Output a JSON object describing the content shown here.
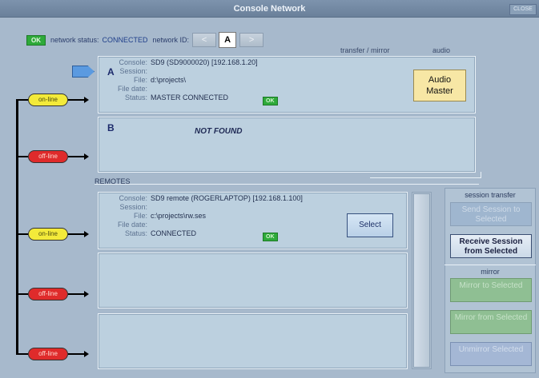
{
  "window": {
    "title": "Console Network",
    "close_label": "CLOSE"
  },
  "network": {
    "ok_badge": "OK",
    "status_label": "network status:",
    "status_value": "CONNECTED",
    "id_label": "network ID:",
    "prev_glyph": "<",
    "next_glyph": ">",
    "id_value": "A"
  },
  "columns": {
    "transfer": "transfer / mirror",
    "audio": "audio"
  },
  "field_labels": {
    "console": "Console:",
    "session": "Session:",
    "file": "File:",
    "file_date": "File date:",
    "status": "Status:"
  },
  "consoles": {
    "a": {
      "letter": "A",
      "console": "SD9 (SD9000020)  [192.168.1.20]",
      "session": "",
      "file": "d:\\projects\\",
      "file_date": "",
      "status": "MASTER CONNECTED",
      "ok": "OK",
      "audio_button": "Audio\nMaster"
    },
    "b": {
      "letter": "B",
      "message": "NOT FOUND"
    }
  },
  "remotes": {
    "label": "REMOTES",
    "items": [
      {
        "console": "SD9 remote (ROGERLAPTOP)  [192.168.1.100]",
        "session": "",
        "file": "c:\\projects\\rw.ses",
        "file_date": "",
        "status": "CONNECTED",
        "ok": "OK",
        "select_label": "Select"
      }
    ]
  },
  "pills": {
    "on_line": "on-line",
    "off_line": "off-line"
  },
  "side": {
    "session_transfer_label": "session transfer",
    "send_label": "Send Session to Selected",
    "receive_label": "Receive Session from Selected",
    "mirror_label": "mirror",
    "mirror_to_label": "Mirror to Selected",
    "mirror_from_label": "Mirror from Selected",
    "unmirror_label": "Unmirror Selected"
  },
  "colors": {
    "online": "#f3ea3a",
    "offline": "#df2b2b",
    "ok": "#2eaa3a",
    "audio_master": "#f7e7a5"
  }
}
